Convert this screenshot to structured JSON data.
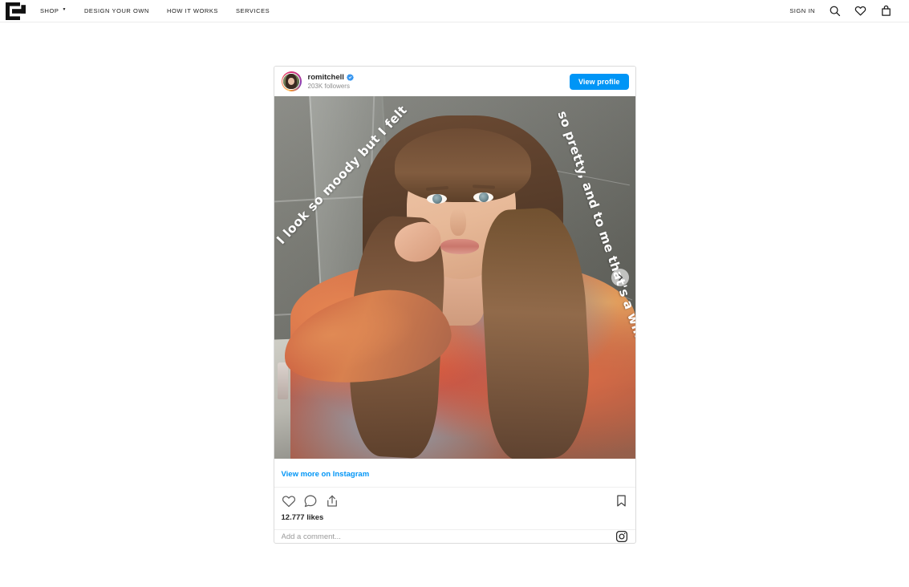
{
  "site": {
    "logo_name": "brand-logo-e",
    "nav": [
      {
        "label": "SHOP",
        "has_dropdown": true
      },
      {
        "label": "DESIGN YOUR OWN",
        "has_dropdown": false
      },
      {
        "label": "HOW IT WORKS",
        "has_dropdown": false
      },
      {
        "label": "SERVICES",
        "has_dropdown": false
      }
    ],
    "sign_in": "SIGN IN",
    "icons": {
      "search": "search-icon",
      "wishlist": "heart-icon",
      "bag": "shopping-bag-icon"
    }
  },
  "embed": {
    "username": "romitchell",
    "verified": true,
    "followers": "203K followers",
    "view_profile_label": "View profile",
    "view_more_label": "View more on Instagram",
    "likes": "12.777 likes",
    "comment_placeholder": "Add a comment...",
    "media": {
      "overlay_text_left": "I look so moody but I felt",
      "overlay_text_right": "so pretty, and to me that's a win",
      "carousel_next_icon": "chevron-right-icon"
    },
    "actions": {
      "like": "heart-icon",
      "comment": "comment-bubble-icon",
      "share": "share-icon",
      "save": "bookmark-icon",
      "instagram": "instagram-glyph-icon"
    },
    "colors": {
      "instagram_blue": "#0095f6",
      "verified_blue": "#3897f0",
      "muted_text": "#8e8e8e",
      "border": "#dbdbdb"
    }
  }
}
